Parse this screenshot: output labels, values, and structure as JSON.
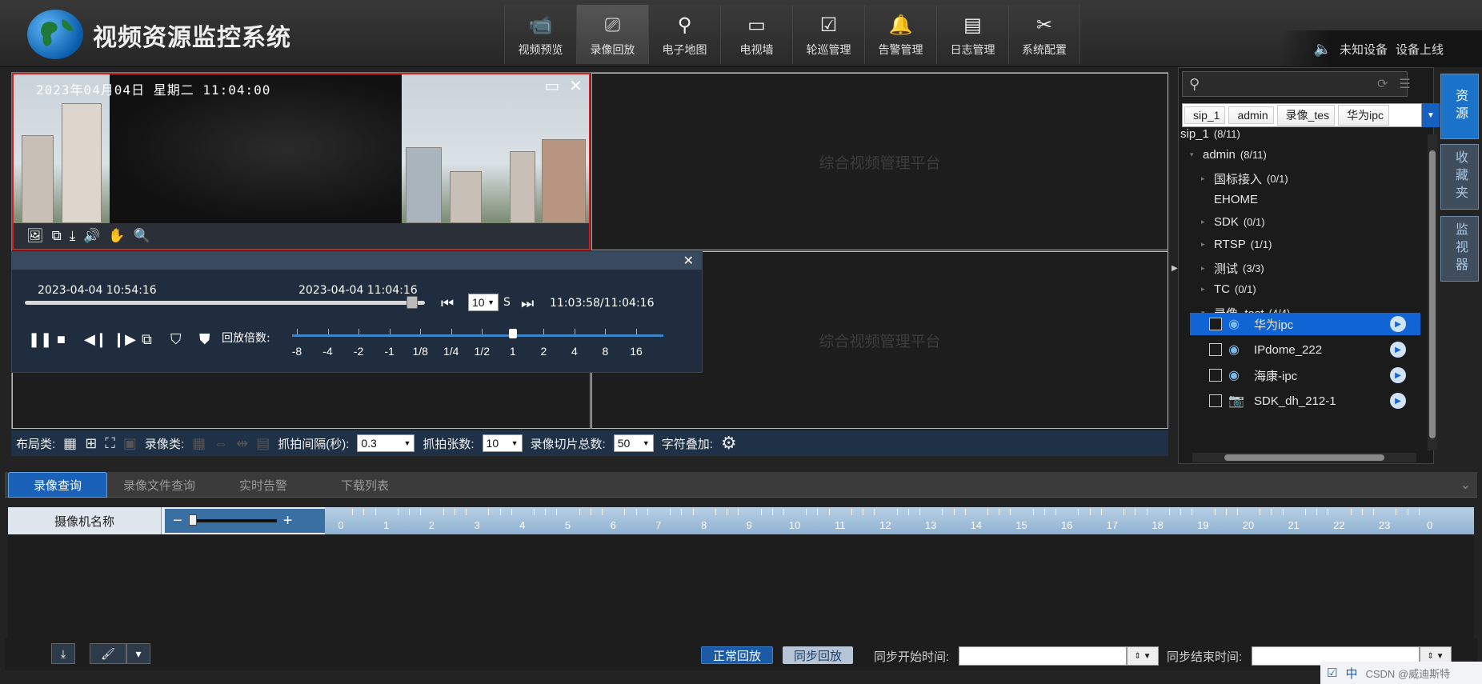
{
  "app": {
    "title": "视频资源监控系统"
  },
  "nav": [
    {
      "label": "视频预览",
      "icon": "camera-icon",
      "glyph": "📹"
    },
    {
      "label": "录像回放",
      "icon": "playback-icon",
      "glyph": "⎚"
    },
    {
      "label": "电子地图",
      "icon": "map-pin-icon",
      "glyph": "⚲"
    },
    {
      "label": "电视墙",
      "icon": "tv-wall-icon",
      "glyph": "▭"
    },
    {
      "label": "轮巡管理",
      "icon": "patrol-icon",
      "glyph": "☑"
    },
    {
      "label": "告警管理",
      "icon": "bell-icon",
      "glyph": "🔔"
    },
    {
      "label": "日志管理",
      "icon": "log-icon",
      "glyph": "▤"
    },
    {
      "label": "系统配置",
      "icon": "tools-icon",
      "glyph": "✂"
    }
  ],
  "nav_active_index": 1,
  "status": {
    "text1": "未知设备",
    "text2": "设备上线"
  },
  "video": {
    "osd": "2023年04月04日 星期二 11:04:00",
    "watermark": "综合视频管理平台"
  },
  "playback": {
    "start_time": "2023-04-04 10:54:16",
    "end_time": "2023-04-04 11:04:16",
    "step_value": "10",
    "step_unit": "S",
    "progress": "11:03:58/11:04:16",
    "progress_fraction": 0.97,
    "speed_label": "回放倍数:",
    "speeds": [
      "-8",
      "-4",
      "-2",
      "-1",
      "1/8",
      "1/4",
      "1/2",
      "1",
      "2",
      "4",
      "8",
      "16"
    ],
    "current_speed_index": 7
  },
  "layout_toolbar": {
    "layout_label": "布局类:",
    "record_label": "录像类:",
    "interval_label": "抓拍间隔(秒):",
    "interval_value": "0.3",
    "count_label": "抓拍张数:",
    "count_value": "10",
    "slices_label": "录像切片总数:",
    "slices_value": "50",
    "overlay_label": "字符叠加:"
  },
  "resources": {
    "search_placeholder": "",
    "breadcrumbs": [
      "sip_1",
      "admin",
      "录像_tes",
      "华为ipc"
    ],
    "tree": [
      {
        "label": "sip_1",
        "count": "(8/11)"
      },
      {
        "label": "admin",
        "count": "(8/11)"
      },
      {
        "label": "国标接入",
        "count": "(0/1)"
      },
      {
        "label": "EHOME",
        "count": ""
      },
      {
        "label": "SDK",
        "count": "(0/1)"
      },
      {
        "label": "RTSP",
        "count": "(1/1)"
      },
      {
        "label": "测试",
        "count": "(3/3)"
      },
      {
        "label": "TC",
        "count": "(0/1)"
      },
      {
        "label": "录像_test",
        "count": "(4/4)"
      }
    ],
    "devices": [
      {
        "label": "华为ipc",
        "selected": true
      },
      {
        "label": "IPdome_222",
        "selected": false
      },
      {
        "label": "海康-ipc",
        "selected": false
      },
      {
        "label": "SDK_dh_212-1",
        "selected": false
      }
    ]
  },
  "side_tabs": [
    "资源",
    "收藏夹",
    "监视器"
  ],
  "bottom_tabs": [
    "录像查询",
    "录像文件查询",
    "实时告警",
    "下载列表"
  ],
  "timeline": {
    "camera_col": "摄像机名称",
    "hours": [
      "0",
      "1",
      "2",
      "3",
      "4",
      "5",
      "6",
      "7",
      "8",
      "9",
      "10",
      "11",
      "12",
      "13",
      "14",
      "15",
      "16",
      "17",
      "18",
      "19",
      "20",
      "21",
      "22",
      "23",
      "0"
    ]
  },
  "bottom_bar": {
    "normal_playback": "正常回放",
    "sync_playback": "同步回放",
    "sync_start_label": "同步开始时间:",
    "sync_end_label": "同步结束时间:"
  },
  "tray": {
    "text": "CSDN @威迪斯特"
  }
}
